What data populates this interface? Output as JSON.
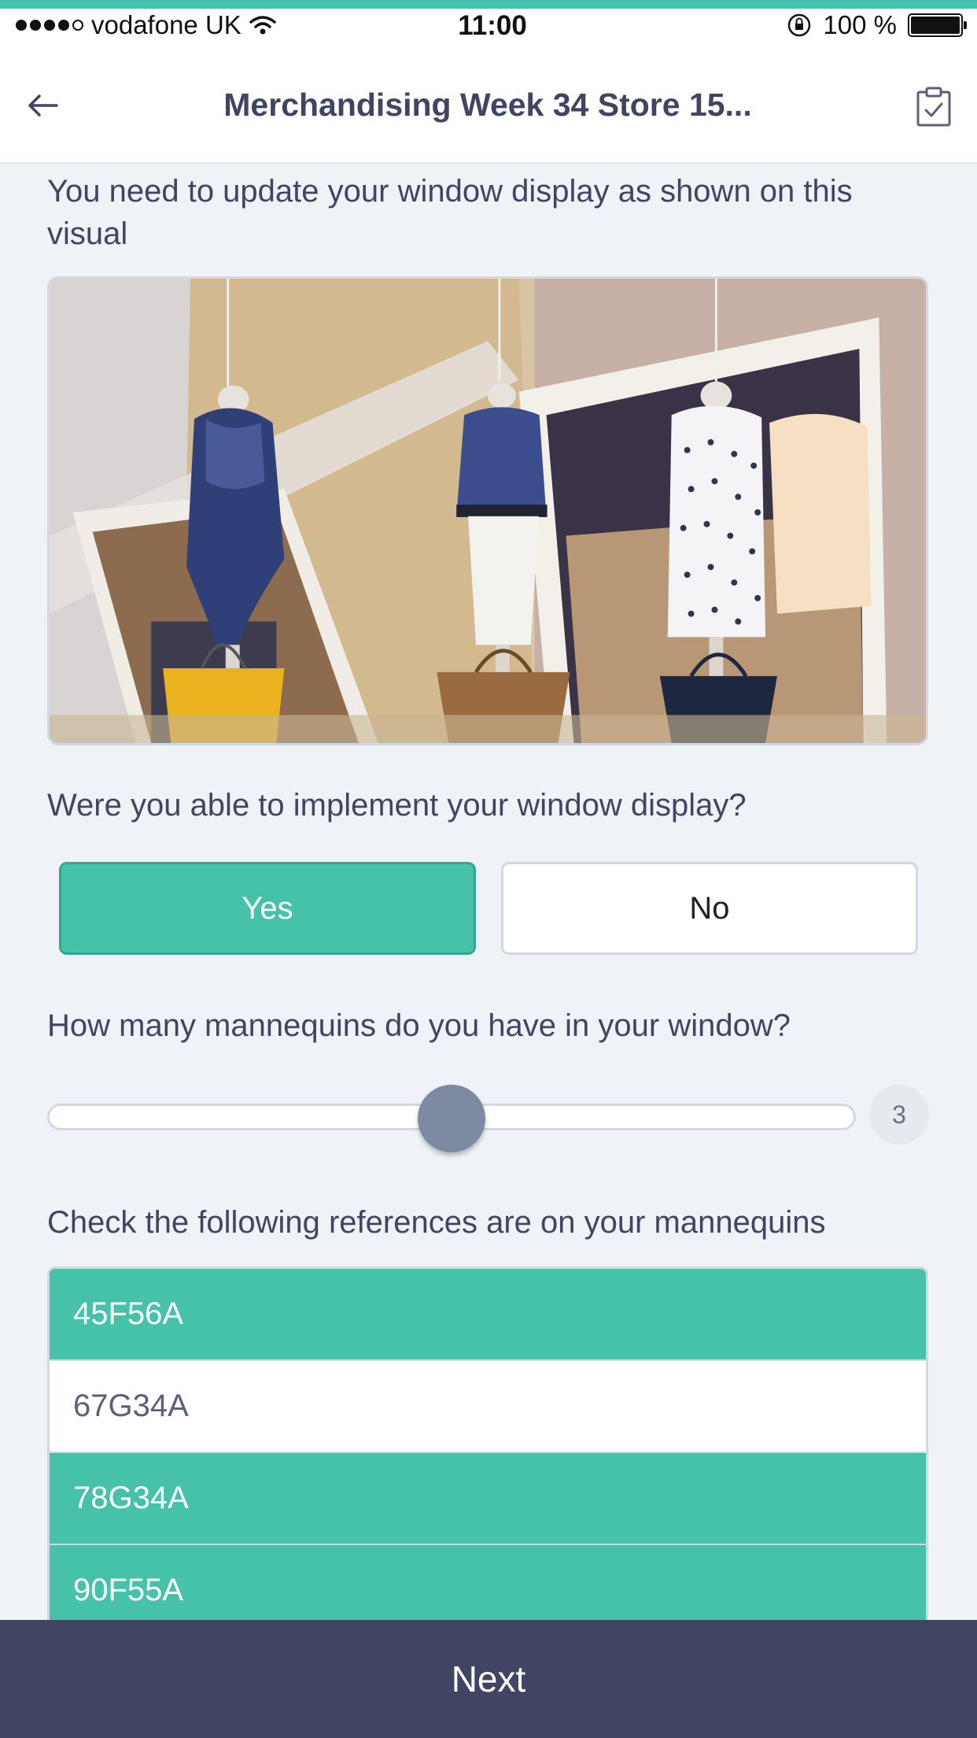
{
  "status_bar": {
    "carrier": "vodafone UK",
    "time": "11:00",
    "battery": "100 %"
  },
  "header": {
    "title": "Merchandising Week 34 Store 15..."
  },
  "questions": {
    "q1": "You need to update your window display as shown on this visual",
    "q2": "Were you able to implement your window display?",
    "q3": "How many mannequins do you have in your window?",
    "q4": "Check the following references are on your mannequins"
  },
  "answer_buttons": {
    "yes_label": "Yes",
    "no_label": "No",
    "selected": "Yes"
  },
  "slider": {
    "value": "3",
    "fraction": 0.5
  },
  "references": [
    {
      "code": "45F56A",
      "checked": true
    },
    {
      "code": "67G34A",
      "checked": false
    },
    {
      "code": "78G34A",
      "checked": true
    },
    {
      "code": "90F55A",
      "checked": true
    }
  ],
  "footer": {
    "next_label": "Next"
  },
  "colors": {
    "accent": "#45c2a8",
    "navy": "#3f4563"
  }
}
